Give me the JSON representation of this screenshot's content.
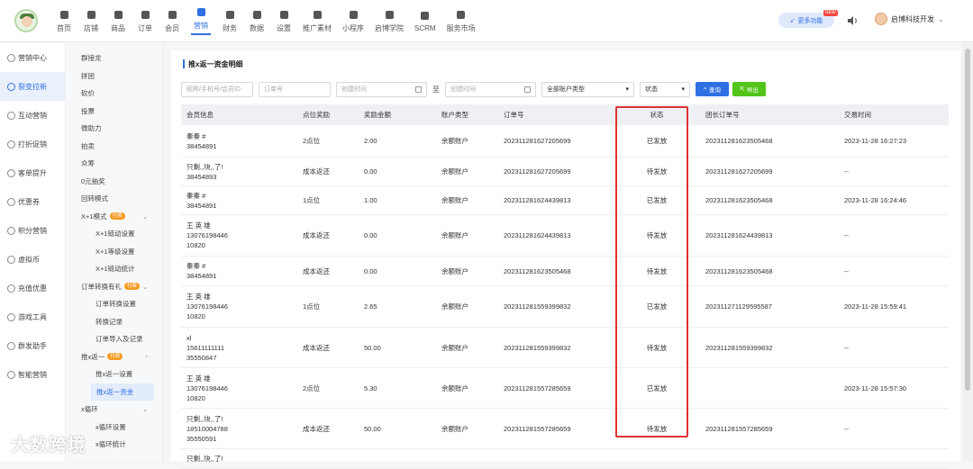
{
  "header": {
    "nav": [
      {
        "label": "首页",
        "icon": "home-icon"
      },
      {
        "label": "店铺",
        "icon": "store-icon"
      },
      {
        "label": "商品",
        "icon": "goods-icon"
      },
      {
        "label": "订单",
        "icon": "order-icon"
      },
      {
        "label": "会员",
        "icon": "member-icon"
      },
      {
        "label": "营销",
        "icon": "marketing-icon",
        "active": true
      },
      {
        "label": "财务",
        "icon": "finance-icon"
      },
      {
        "label": "数据",
        "icon": "data-icon"
      },
      {
        "label": "设置",
        "icon": "settings-icon"
      },
      {
        "label": "推广素材",
        "icon": "share-icon"
      },
      {
        "label": "小程序",
        "icon": "miniapp-icon"
      },
      {
        "label": "启博学院",
        "icon": "college-icon"
      },
      {
        "label": "SCRM",
        "icon": "scrm-icon"
      },
      {
        "label": "服务市场",
        "icon": "market-icon"
      }
    ],
    "more_label": "更多功能",
    "new_tag": "NEW",
    "user_name": "启博科技开发"
  },
  "sidebar": {
    "items": [
      {
        "label": "营销中心"
      },
      {
        "label": "裂变拉新",
        "active": true
      },
      {
        "label": "互动营销"
      },
      {
        "label": "打折促销"
      },
      {
        "label": "客单提升"
      },
      {
        "label": "优惠券"
      },
      {
        "label": "积分营销"
      },
      {
        "label": "虚拟币"
      },
      {
        "label": "充值优惠"
      },
      {
        "label": "游戏工具"
      },
      {
        "label": "群发助手"
      },
      {
        "label": "智能营销"
      }
    ]
  },
  "subnav": {
    "items": [
      {
        "label": "群接龙"
      },
      {
        "label": "拼团"
      },
      {
        "label": "砍价"
      },
      {
        "label": "投票"
      },
      {
        "label": "微助力"
      },
      {
        "label": "拍卖"
      },
      {
        "label": "众筹"
      },
      {
        "label": "0元抽奖"
      },
      {
        "label": "回转模式"
      },
      {
        "label": "X+1模式",
        "tag": "付费",
        "expanded": true
      },
      {
        "label": "X+1链动设置",
        "sub": true
      },
      {
        "label": "X+1等级设置",
        "sub": true
      },
      {
        "label": "X+1链动统计",
        "sub": true
      },
      {
        "label": "订单转换有礼",
        "tag": "付费",
        "expanded": true
      },
      {
        "label": "订单转换设置",
        "sub": true
      },
      {
        "label": "转换记录",
        "sub": true
      },
      {
        "label": "订单导入及记录",
        "sub": true
      },
      {
        "label": "推x返一",
        "tag": "付费",
        "collapsed": true
      },
      {
        "label": "推x返一设置",
        "sub": true
      },
      {
        "label": "推x返一资金",
        "sub": true,
        "active": true
      },
      {
        "label": "x循环",
        "expanded": true
      },
      {
        "label": "x循环设置",
        "sub": true
      },
      {
        "label": "x循环统计",
        "sub": true
      }
    ]
  },
  "page": {
    "title": "推x返一资金明细",
    "filters": {
      "member_placeholder": "昵称/手机号/会员ID",
      "order_placeholder": "订单号",
      "start_placeholder": "创建时间",
      "range_sep": "至",
      "end_placeholder": "创建时间",
      "account_type": "全部账户类型",
      "status": "状态",
      "query_label": "查询",
      "export_label": "导出"
    },
    "table": {
      "columns": [
        "会员信息",
        "点位奖励",
        "奖励金额",
        "账户类型",
        "订单号",
        "状态",
        "团长订单号",
        "交易时间"
      ],
      "rows": [
        {
          "member": "秦秦 #\n38454891",
          "reward": "2点位",
          "amount": "2.00",
          "account": "余额账户",
          "order": "202311281627205699",
          "status": "已发放",
          "leader_order": "202311281623505468",
          "time": "2023-11-28 16:27:23",
          "h": 36
        },
        {
          "member": "只剩,,块,,了!\n38454893",
          "reward": "成本返还",
          "amount": "0.00",
          "account": "余额账户",
          "order": "202311281627205699",
          "status": "待发放",
          "leader_order": "202311281627205699",
          "time": "--",
          "h": 32
        },
        {
          "member": "秦秦 #\n38454891",
          "reward": "1点位",
          "amount": "1.00",
          "account": "余额账户",
          "order": "202311281624439813",
          "status": "已发放",
          "leader_order": "202311281623505468",
          "time": "2023-11-28 16:24:46",
          "h": 32
        },
        {
          "member": "王 英 雄\n13076198446\n10820",
          "reward": "成本返还",
          "amount": "0.00",
          "account": "余额账户",
          "order": "202311281624439813",
          "status": "待发放",
          "leader_order": "202311281624439813",
          "time": "--",
          "h": 46
        },
        {
          "member": "秦秦 #\n38454891",
          "reward": "成本返还",
          "amount": "0.00",
          "account": "余额账户",
          "order": "202311281623505468",
          "status": "待发放",
          "leader_order": "202311281623505468",
          "time": "--",
          "h": 33
        },
        {
          "member": "王 英 雄\n13076198446\n10820",
          "reward": "1点位",
          "amount": "2.65",
          "account": "余额账户",
          "order": "202311281559399832",
          "status": "已发放",
          "leader_order": "202311271129595587",
          "time": "2023-11-28 15:59:41",
          "h": 46
        },
        {
          "member": "xl\n15611111111\n35550847",
          "reward": "成本返还",
          "amount": "50.00",
          "account": "余额账户",
          "order": "202311281559399832",
          "status": "待发放",
          "leader_order": "202311281559399832",
          "time": "--",
          "h": 45
        },
        {
          "member": "王 英 雄\n13076198446\n10820",
          "reward": "2点位",
          "amount": "5.30",
          "account": "余额账户",
          "order": "202311281557285659",
          "status": "已发放",
          "leader_order": "",
          "time": "2023-11-28 15:57:30",
          "h": 45
        },
        {
          "member": "只剩,,块,,了!\n18510004788\n35550591",
          "reward": "成本返还",
          "amount": "50.00",
          "account": "余额账户",
          "order": "202311281557285659",
          "status": "待发放",
          "leader_order": "202311281557285659",
          "time": "--",
          "h": 45
        },
        {
          "member": "只剩,,块,,了!",
          "reward": "",
          "amount": "",
          "account": "",
          "order": "",
          "status": "",
          "leader_order": "",
          "time": "",
          "h": 22
        }
      ]
    }
  },
  "watermark": "大数跨境",
  "colors": {
    "accent": "#2f6fe4",
    "highlight": "#e03232",
    "export": "#52c41a"
  }
}
